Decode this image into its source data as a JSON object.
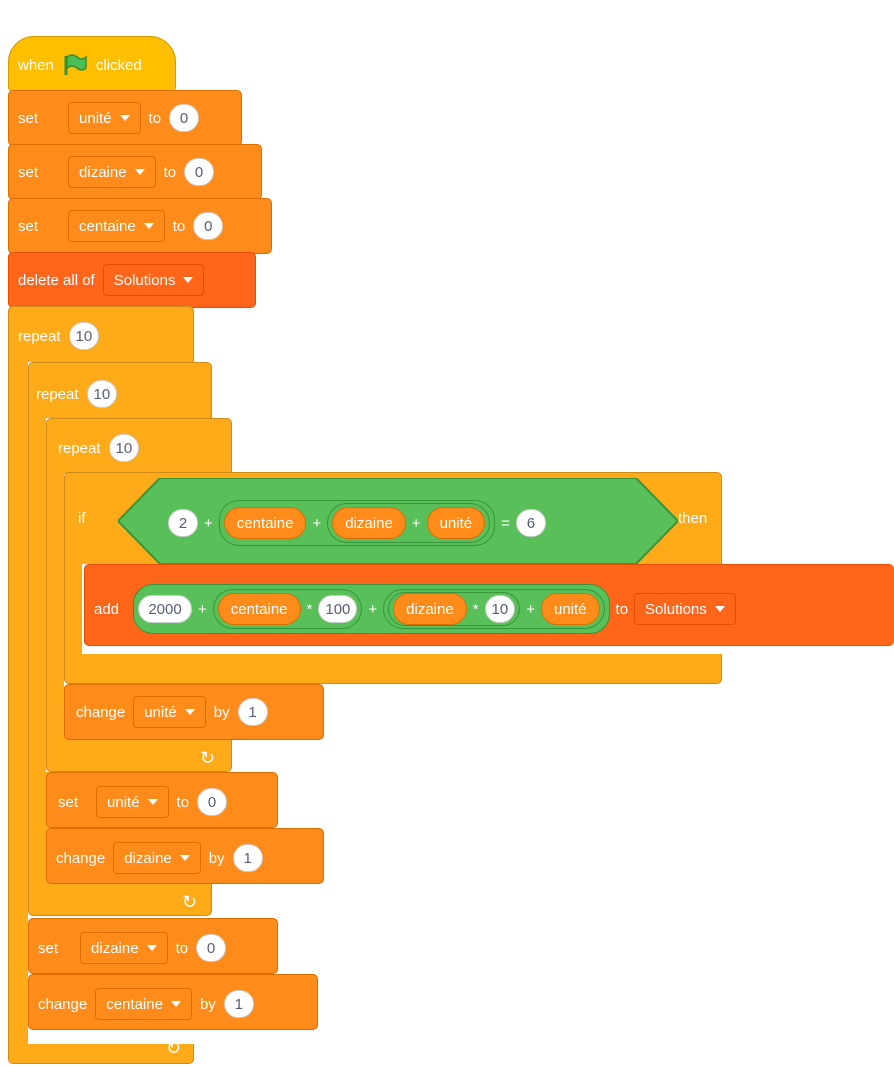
{
  "hat": {
    "when": "when",
    "clicked": "clicked",
    "icon": "green-flag-icon"
  },
  "set1": {
    "label": "set",
    "var": "unité",
    "to": "to",
    "value": "0"
  },
  "set2": {
    "label": "set",
    "var": "dizaine",
    "to": "to",
    "value": "0"
  },
  "set3": {
    "label": "set",
    "var": "centaine",
    "to": "to",
    "value": "0"
  },
  "del": {
    "label": "delete all of",
    "list": "Solutions"
  },
  "rep1": {
    "label": "repeat",
    "value": "10"
  },
  "rep2": {
    "label": "repeat",
    "value": "10"
  },
  "rep3": {
    "label": "repeat",
    "value": "10"
  },
  "cond": {
    "if": "if",
    "then": "then",
    "n2": "2",
    "plus": "+",
    "centaine": "centaine",
    "dizaine": "dizaine",
    "unite": "unité",
    "eq": "=",
    "six": "6"
  },
  "add": {
    "label": "add",
    "v2000": "2000",
    "plus": "+",
    "centaine": "centaine",
    "times": "*",
    "v100": "100",
    "dizaine": "dizaine",
    "v10": "10",
    "unite": "unité",
    "to": "to",
    "list": "Solutions"
  },
  "chg1": {
    "label": "change",
    "var": "unité",
    "by": "by",
    "value": "1"
  },
  "set4": {
    "label": "set",
    "var": "unité",
    "to": "to",
    "value": "0"
  },
  "chg2": {
    "label": "change",
    "var": "dizaine",
    "by": "by",
    "value": "1"
  },
  "set5": {
    "label": "set",
    "var": "dizaine",
    "to": "to",
    "value": "0"
  },
  "chg3": {
    "label": "change",
    "var": "centaine",
    "by": "by",
    "value": "1"
  },
  "colors": {
    "events": "#FFBF00",
    "variables": "#FF8C1A",
    "lists": "#FF661A",
    "control": "#FFAB19",
    "operators": "#59C059"
  }
}
